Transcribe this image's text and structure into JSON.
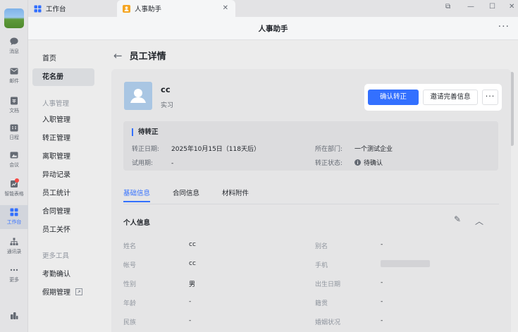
{
  "rail": {
    "items": [
      {
        "label": "消息",
        "icon": "chat-bubble-icon"
      },
      {
        "label": "邮件",
        "icon": "mail-icon"
      },
      {
        "label": "文档",
        "icon": "document-icon"
      },
      {
        "label": "日程",
        "icon": "calendar-icon"
      },
      {
        "label": "会议",
        "icon": "video-meeting-icon"
      },
      {
        "label": "智能表格",
        "icon": "smart-sheet-icon"
      },
      {
        "label": "工作台",
        "icon": "workbench-grid-icon"
      },
      {
        "label": "通讯录",
        "icon": "contacts-org-icon"
      },
      {
        "label": "更多",
        "icon": "more-dots-icon"
      }
    ]
  },
  "tabs": {
    "workbench": "工作台",
    "hr_assistant": "人事助手",
    "close": "✕"
  },
  "header": {
    "title": "人事助手",
    "more": "···"
  },
  "sidebar": {
    "home": "首页",
    "roster": "花名册",
    "group_hr": "人事管理",
    "onboarding": "入职管理",
    "regularization": "转正管理",
    "resignation": "离职管理",
    "changes": "异动记录",
    "stats": "员工统计",
    "contracts": "合同管理",
    "care": "员工关怀",
    "group_tools": "更多工具",
    "attendance": "考勤确认",
    "leave": "假期管理"
  },
  "page": {
    "back": "←",
    "title": "员工详情"
  },
  "employee": {
    "name": "cc",
    "type": "实习"
  },
  "actions": {
    "confirm": "确认转正",
    "invite": "邀请完善信息",
    "more": "···"
  },
  "status": {
    "title": "待转正",
    "date_label": "转正日期:",
    "date_value": "2025年10月15日（118天后）",
    "probation_label": "试用期:",
    "probation_value": "-",
    "dept_label": "所在部门:",
    "dept_value": "一个测试企业",
    "state_label": "转正状态:",
    "state_value": "待确认"
  },
  "detail_tabs": [
    "基础信息",
    "合同信息",
    "材料附件"
  ],
  "personal": {
    "title": "个人信息",
    "fields_left": [
      {
        "k": "姓名",
        "v": "cc"
      },
      {
        "k": "帐号",
        "v": "cc"
      },
      {
        "k": "性别",
        "v": "男"
      },
      {
        "k": "年龄",
        "v": "-"
      },
      {
        "k": "民族",
        "v": "-"
      }
    ],
    "fields_right": [
      {
        "k": "别名",
        "v": "-"
      },
      {
        "k": "手机",
        "v": ""
      },
      {
        "k": "出生日期",
        "v": "-"
      },
      {
        "k": "籍贯",
        "v": "-"
      },
      {
        "k": "婚姻状况",
        "v": "-"
      }
    ]
  },
  "colors": {
    "accent": "#3370ff",
    "badge": "#f54a45"
  }
}
